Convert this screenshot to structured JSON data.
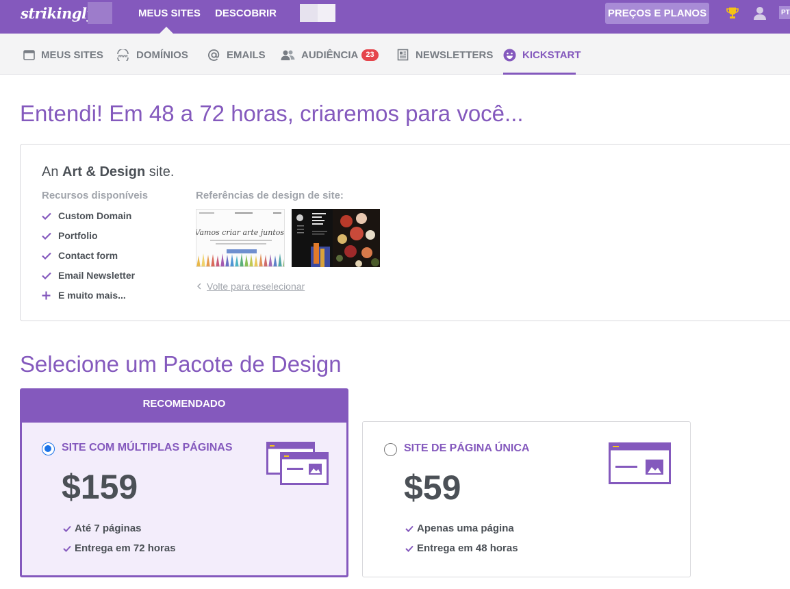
{
  "topbar": {
    "logo": "strikingly",
    "nav": [
      "MEUS SITES",
      "DESCOBRIR"
    ],
    "pricing_button": "PREÇOS E PLANOS",
    "lang": "PT",
    "colors": {
      "brand": "#8459bd",
      "pricing_button": "#a88bd6"
    }
  },
  "subnav": {
    "items": [
      {
        "label": "MEUS SITES",
        "icon": "browser-window-icon"
      },
      {
        "label": "DOMÍNIOS",
        "icon": "www-globe-icon"
      },
      {
        "label": "EMAILS",
        "icon": "at-sign-icon"
      },
      {
        "label": "AUDIÊNCIA",
        "icon": "people-icon",
        "badge": "23"
      },
      {
        "label": "NEWSLETTERS",
        "icon": "newsletter-icon"
      },
      {
        "label": "KICKSTART",
        "icon": "smiley-icon",
        "active": true
      }
    ]
  },
  "main": {
    "title": "Entendi! Em 48 a 72 horas, criaremos para você...",
    "site_type": {
      "prefix": "An",
      "name": "Art & Design",
      "suffix": "site."
    },
    "resources_heading": "Recursos disponíveis",
    "resources": [
      {
        "label": "Custom Domain",
        "icon": "check-icon"
      },
      {
        "label": "Portfolio",
        "icon": "check-icon"
      },
      {
        "label": "Contact form",
        "icon": "check-icon"
      },
      {
        "label": "Email Newsletter",
        "icon": "check-icon"
      },
      {
        "label": "E muito mais...",
        "icon": "plus-icon"
      }
    ],
    "references_heading": "Referências de design de site:",
    "thumb1_text": "Vamos criar arte juntos!",
    "back_link": "Volte para reselecionar"
  },
  "packages": {
    "title": "Selecione um Pacote de Design",
    "recommended_label": "RECOMENDADO",
    "multi": {
      "name": "SITE COM MÚLTIPLAS PÁGINAS",
      "price": "$159",
      "features": [
        "Até 7 páginas",
        "Entrega em 72 horas"
      ],
      "selected": true
    },
    "single": {
      "name": "SITE DE PÁGINA ÚNICA",
      "price": "$59",
      "features": [
        "Apenas uma página",
        "Entrega em 48 horas"
      ],
      "selected": false
    }
  }
}
